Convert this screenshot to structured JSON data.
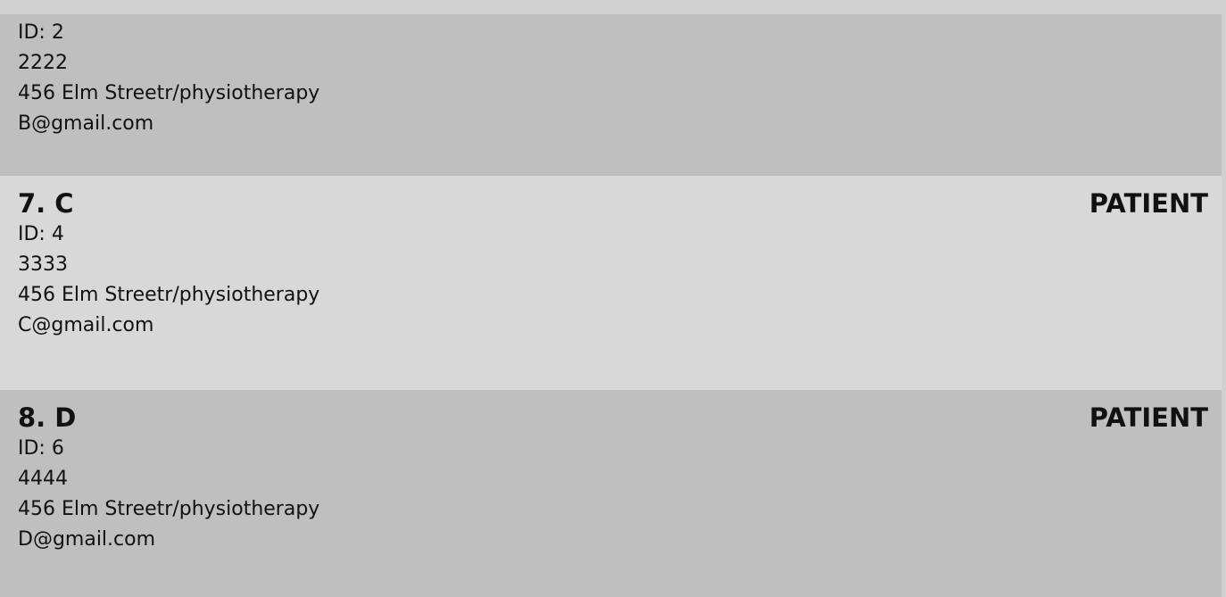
{
  "people": [
    {
      "id_line": "ID: 2",
      "phone": "2222",
      "address": "456 Elm Streetr/physiotherapy",
      "email": "B@gmail.com"
    },
    {
      "title": "7. C",
      "role": "PATIENT",
      "id_line": "ID: 4",
      "phone": "3333",
      "address": "456 Elm Streetr/physiotherapy",
      "email": "C@gmail.com"
    },
    {
      "title": "8. D",
      "role": "PATIENT",
      "id_line": "ID: 6",
      "phone": "4444",
      "address": "456 Elm Streetr/physiotherapy",
      "email": "D@gmail.com"
    }
  ]
}
